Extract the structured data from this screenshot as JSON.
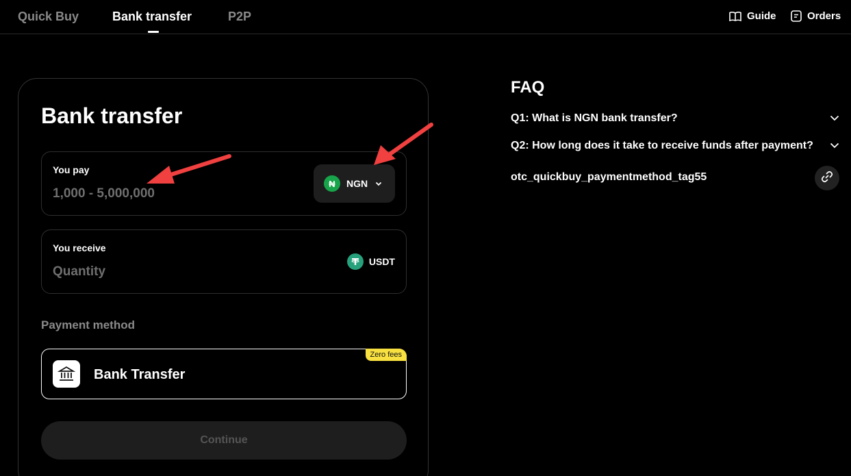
{
  "nav": {
    "tabs": [
      {
        "label": "Quick Buy",
        "active": false
      },
      {
        "label": "Bank transfer",
        "active": true
      },
      {
        "label": "P2P",
        "active": false
      }
    ],
    "guide_label": "Guide",
    "orders_label": "Orders"
  },
  "card": {
    "title": "Bank transfer",
    "pay": {
      "label": "You pay",
      "placeholder": "1,000 - 5,000,000",
      "currency": "NGN",
      "currency_symbol": "₦"
    },
    "receive": {
      "label": "You receive",
      "placeholder": "Quantity",
      "currency": "USDT"
    },
    "payment_method_label": "Payment method",
    "payment_method": {
      "name": "Bank Transfer",
      "badge": "Zero fees"
    },
    "continue_label": "Continue"
  },
  "faq": {
    "title": "FAQ",
    "items": [
      {
        "question": "Q1: What is NGN bank transfer?"
      },
      {
        "question": "Q2: How long does it take to receive funds after payment?"
      }
    ],
    "tag": "otc_quickbuy_paymentmethod_tag55"
  },
  "colors": {
    "background": "#000000",
    "accent_badge": "#f7e040",
    "ngn_coin": "#18a44a",
    "usdt_coin": "#26a17b",
    "annotation_arrow": "#f04040"
  }
}
